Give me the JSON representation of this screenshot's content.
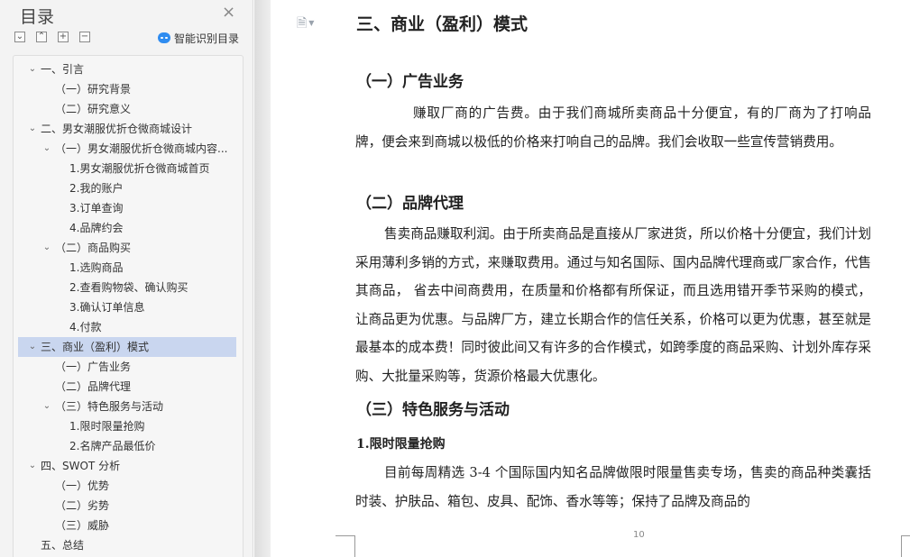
{
  "sidebar": {
    "title": "目录",
    "close_glyph": "×",
    "tools": [
      {
        "glyph": "⌄",
        "name": "collapse-all-button"
      },
      {
        "glyph": "⌃",
        "name": "expand-all-button"
      },
      {
        "glyph": "+",
        "name": "add-heading-button"
      },
      {
        "glyph": "−",
        "name": "remove-heading-button"
      }
    ],
    "ai_label": "智能识别目录",
    "toc": [
      {
        "label": "一、引言",
        "level": 0,
        "caret": "open"
      },
      {
        "label": "（一）研究背景",
        "level": 1,
        "caret": "none"
      },
      {
        "label": "（二）研究意义",
        "level": 1,
        "caret": "none"
      },
      {
        "label": "二、男女潮服优折仓微商城设计",
        "level": 0,
        "caret": "open"
      },
      {
        "label": "（一）男女潮服优折仓微商城内容...",
        "level": 1,
        "caret": "open"
      },
      {
        "label": "1.男女潮服优折仓微商城首页",
        "level": 2,
        "caret": "none"
      },
      {
        "label": "2.我的账户",
        "level": 2,
        "caret": "none"
      },
      {
        "label": "3.订单查询",
        "level": 2,
        "caret": "none"
      },
      {
        "label": "4.品牌约会",
        "level": 2,
        "caret": "none"
      },
      {
        "label": "（二）商品购买",
        "level": 1,
        "caret": "open"
      },
      {
        "label": "1.选购商品",
        "level": 2,
        "caret": "none"
      },
      {
        "label": "2.查看购物袋、确认购买",
        "level": 2,
        "caret": "none"
      },
      {
        "label": "3.确认订单信息",
        "level": 2,
        "caret": "none"
      },
      {
        "label": "4.付款",
        "level": 2,
        "caret": "none"
      },
      {
        "label": "三、商业（盈利）模式",
        "level": 0,
        "caret": "open",
        "selected": true
      },
      {
        "label": "（一）广告业务",
        "level": 1,
        "caret": "none"
      },
      {
        "label": "（二）品牌代理",
        "level": 1,
        "caret": "none"
      },
      {
        "label": "（三）特色服务与活动",
        "level": 1,
        "caret": "open"
      },
      {
        "label": "1.限时限量抢购",
        "level": 2,
        "caret": "none"
      },
      {
        "label": "2.名牌产品最低价",
        "level": 2,
        "caret": "none"
      },
      {
        "label": "四、SWOT 分析",
        "level": 0,
        "caret": "open"
      },
      {
        "label": "（一）优势",
        "level": 1,
        "caret": "none"
      },
      {
        "label": "（二）劣势",
        "level": 1,
        "caret": "none"
      },
      {
        "label": "（三）威胁",
        "level": 1,
        "caret": "none"
      },
      {
        "label": "五、总结",
        "level": 0,
        "caret": "none"
      }
    ]
  },
  "document": {
    "doc_icon_glyph": "🗎",
    "heading": "三、商业（盈利）模式",
    "sub1": "（一）广告业务",
    "para1": "赚取厂商的广告费。由于我们商城所卖商品十分便宜，有的厂商为了打响品牌，便会来到商城以极低的价格来打响自己的品牌。我们会收取一些宣传营销费用。",
    "sub2": "（二）品牌代理",
    "para2": "售卖商品赚取利润。由于所卖商品是直接从厂家进货，所以价格十分便宜，我们计划采用薄利多销的方式，来赚取费用。通过与知名国际、国内品牌代理商或厂家合作，代售其商品， 省去中间商费用，在质量和价格都有所保证，而且选用错开季节采购的模式，让商品更为优惠。与品牌厂方，建立长期合作的信任关系，价格可以更为优惠，甚至就是最基本的成本费！同时彼此间又有许多的合作模式，如跨季度的商品采购、计划外库存采购、大批量采购等，货源价格最大优惠化。",
    "sub3": "（三）特色服务与活动",
    "sub3_1": "1.限时限量抢购",
    "para3": "目前每周精选 3-4 个国际国内知名品牌做限时限量售卖专场，售卖的商品种类囊括时装、护肤品、箱包、皮具、配饰、香水等等；保持了品牌及商品的",
    "page_number": "10"
  }
}
